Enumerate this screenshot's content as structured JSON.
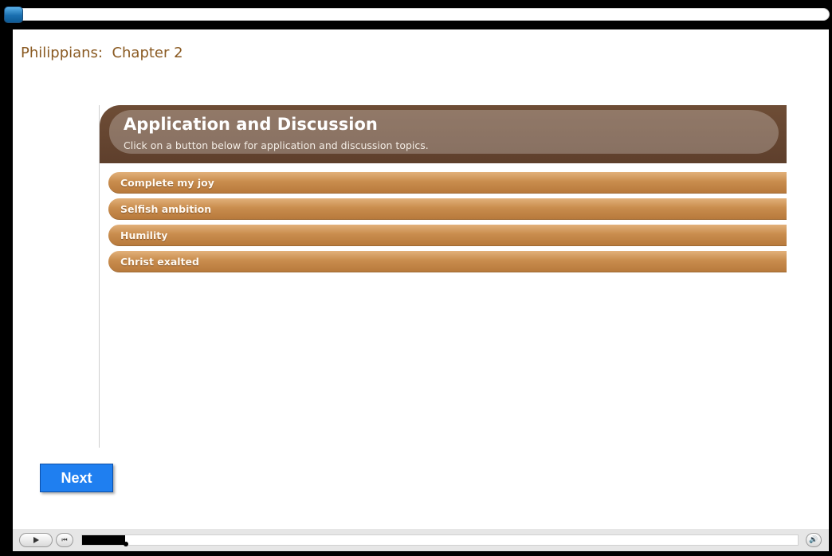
{
  "player": {
    "top_progress": 0.0,
    "scrub_progress": 0.06
  },
  "page": {
    "title": "Philippians:  Chapter 2"
  },
  "panel": {
    "title": "Application and Discussion",
    "subtitle": "Click on a button below for application and discussion topics.",
    "topics": [
      {
        "label": "Complete my joy"
      },
      {
        "label": "Selfish ambition"
      },
      {
        "label": "Humility"
      },
      {
        "label": "Christ exalted"
      }
    ]
  },
  "navigation": {
    "next_label": "Next"
  },
  "controls": {
    "play_icon": "play-icon",
    "rewind_icon": "rewind-icon",
    "volume_icon": "volume-icon",
    "rewind_glyph": "⏮",
    "volume_glyph": "🔊"
  },
  "colors": {
    "title": "#8a5a22",
    "header_brown": "#6e4d36",
    "topic_tan": "#c98d4e",
    "next_blue": "#1f7ff0"
  }
}
